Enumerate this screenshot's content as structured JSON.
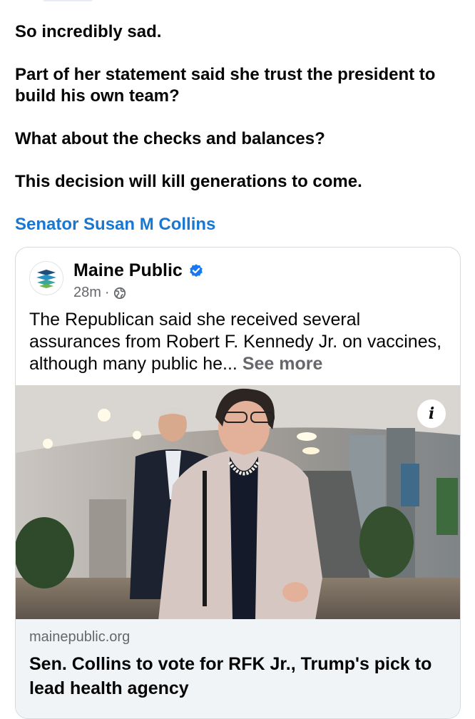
{
  "post": {
    "paragraphs": [
      "So incredibly sad.",
      "Part of her statement said she trust the president to build his own team?",
      "What about the checks and balances?",
      "This decision will kill generations to come."
    ],
    "mention": "Senator Susan M Collins"
  },
  "shared_post": {
    "page_name": "Maine Public",
    "verified_icon": "verified-badge-icon",
    "time": "28m",
    "audience_icon": "globe-icon",
    "text": "The Republican said she received several assurances from Robert F. Kennedy Jr. on vaccines, although many public he...",
    "see_more": "See more",
    "info_button_icon": "info-icon"
  },
  "link_preview": {
    "domain": "mainepublic.org",
    "headline": "Sen. Collins to vote for RFK Jr., Trump's pick to lead health agency"
  },
  "colors": {
    "mention": "#1877d2",
    "verified": "#1877f2",
    "link_box_bg": "#f0f4f7"
  }
}
